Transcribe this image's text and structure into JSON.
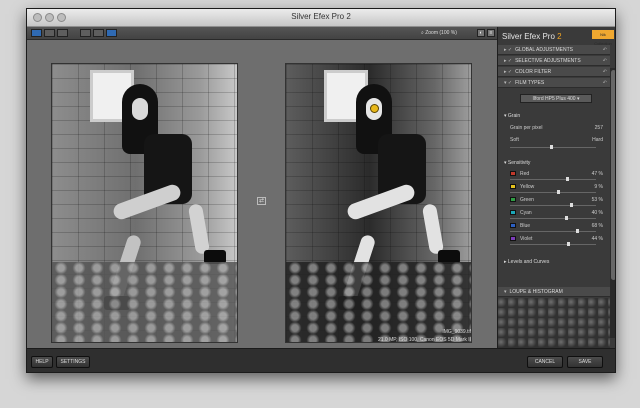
{
  "window": {
    "title": "Silver Efex Pro 2"
  },
  "toolbar": {
    "zoom_label": "Zoom (100 %)"
  },
  "brand": {
    "name": "Silver Efex Pro",
    "version": "2",
    "badge": "Nik Collection"
  },
  "panel": {
    "sections": [
      {
        "label": "GLOBAL ADJUSTMENTS"
      },
      {
        "label": "SELECTIVE ADJUSTMENTS"
      },
      {
        "label": "COLOR FILTER"
      },
      {
        "label": "FILM TYPES"
      }
    ],
    "film_preset": "Ilford HP5 Plus 400",
    "grain": {
      "title": "Grain",
      "per_pixel_label": "Grain per pixel",
      "per_pixel_value": "257",
      "soft_label": "Soft",
      "hard_label": "Hard"
    },
    "sensitivity": {
      "title": "Sensitivity",
      "channels": [
        {
          "label": "Red",
          "value": "47 %",
          "color": "#c0392b"
        },
        {
          "label": "Yellow",
          "value": "9 %",
          "color": "#e5c21d"
        },
        {
          "label": "Green",
          "value": "53 %",
          "color": "#2f9e44"
        },
        {
          "label": "Cyan",
          "value": "40 %",
          "color": "#1ba7b8"
        },
        {
          "label": "Blue",
          "value": "68 %",
          "color": "#2b5fc1"
        },
        {
          "label": "Violet",
          "value": "44 %",
          "color": "#7b3db8"
        }
      ]
    },
    "levels_label": "Levels and Curves",
    "loupe_label": "LOUPE & HISTOGRAM"
  },
  "image": {
    "filename": "IMG_9039.tif",
    "meta": "21.0 MP, ISO 100, Canon EOS 5D Mark II"
  },
  "buttons": {
    "help": "HELP",
    "settings": "SETTINGS",
    "cancel": "CANCEL",
    "save": "SAVE"
  },
  "colors": {
    "accent": "#f4a623",
    "selected": "#2f6ab3"
  }
}
